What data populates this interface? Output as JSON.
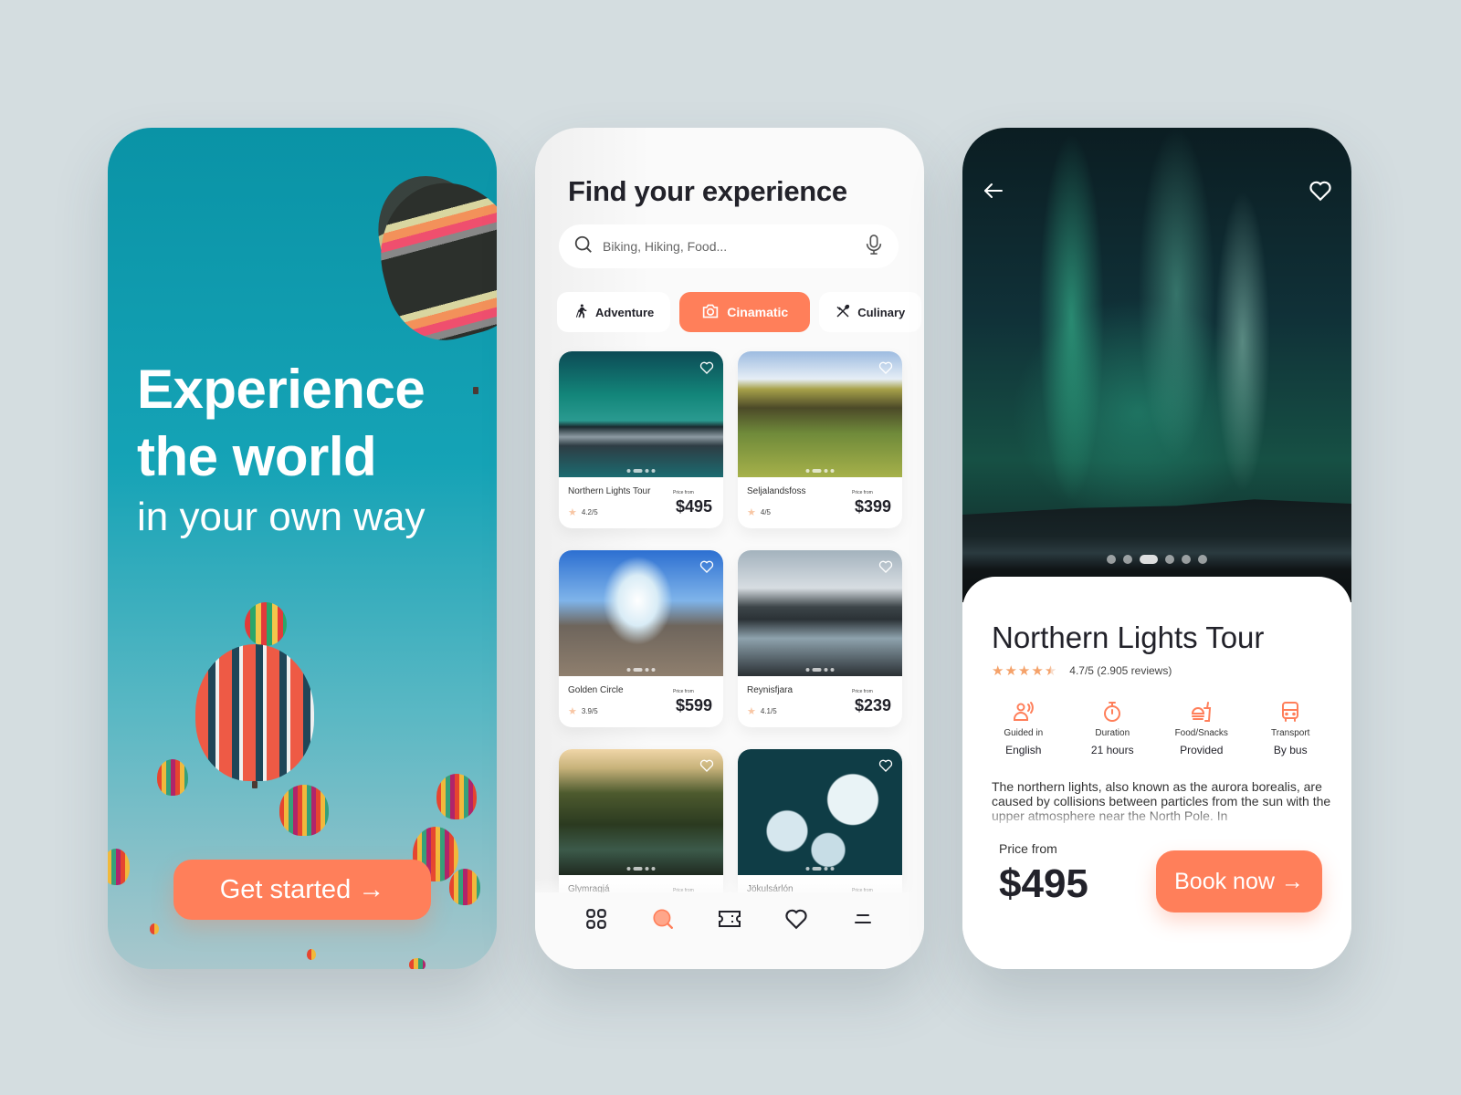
{
  "onboarding": {
    "headline_line1": "Experience",
    "headline_line2": "the world",
    "subheadline": "in your own way",
    "cta_label": "Get started →"
  },
  "explore": {
    "title": "Find your experience",
    "search": {
      "placeholder": "Biking, Hiking, Food...",
      "value": ""
    },
    "categories": [
      {
        "label": "Adventure",
        "icon": "hiking-icon",
        "active": false
      },
      {
        "label": "Cinamatic",
        "icon": "camera-icon",
        "active": true
      },
      {
        "label": "Culinary",
        "icon": "utensils-icon",
        "active": false
      }
    ],
    "price_label": "Price from",
    "cards": [
      {
        "name": "Northern Lights Tour",
        "rating": "4.2/5",
        "price": "$495"
      },
      {
        "name": "Seljalandsfoss",
        "rating": "4/5",
        "price": "$399"
      },
      {
        "name": "Golden Circle",
        "rating": "3.9/5",
        "price": "$599"
      },
      {
        "name": "Reynisfjara",
        "rating": "4.1/5",
        "price": "$239"
      },
      {
        "name": "Glymragjá",
        "rating": "",
        "price": ""
      },
      {
        "name": "Jökulsárlón",
        "rating": "",
        "price": ""
      }
    ],
    "tabbar": [
      {
        "icon": "grid-icon",
        "active": false
      },
      {
        "icon": "search-icon",
        "active": true
      },
      {
        "icon": "ticket-icon",
        "active": false
      },
      {
        "icon": "heart-icon",
        "active": false
      },
      {
        "icon": "menu-icon",
        "active": false
      }
    ]
  },
  "detail": {
    "title": "Northern Lights Tour",
    "rating_value": 4.7,
    "rating_text": "4.7/5 (2.905 reviews)",
    "carousel": {
      "count": 6,
      "active_index": 2
    },
    "features": [
      {
        "icon": "guide-icon",
        "label": "Guided in",
        "value": "English"
      },
      {
        "icon": "stopwatch-icon",
        "label": "Duration",
        "value": "21 hours"
      },
      {
        "icon": "food-icon",
        "label": "Food/Snacks",
        "value": "Provided"
      },
      {
        "icon": "bus-icon",
        "label": "Transport",
        "value": "By bus"
      }
    ],
    "description": "The northern lights, also known as the aurora borealis, are caused by collisions between particles from the sun with the upper atmosphere near the North Pole. In",
    "price_label": "Price from",
    "price": "$495",
    "cta_label": "Book now →"
  },
  "colors": {
    "accent": "#ff7f5a",
    "background": "#d4dde0",
    "text_dark": "#22222a",
    "teal": "#0a93a6"
  }
}
